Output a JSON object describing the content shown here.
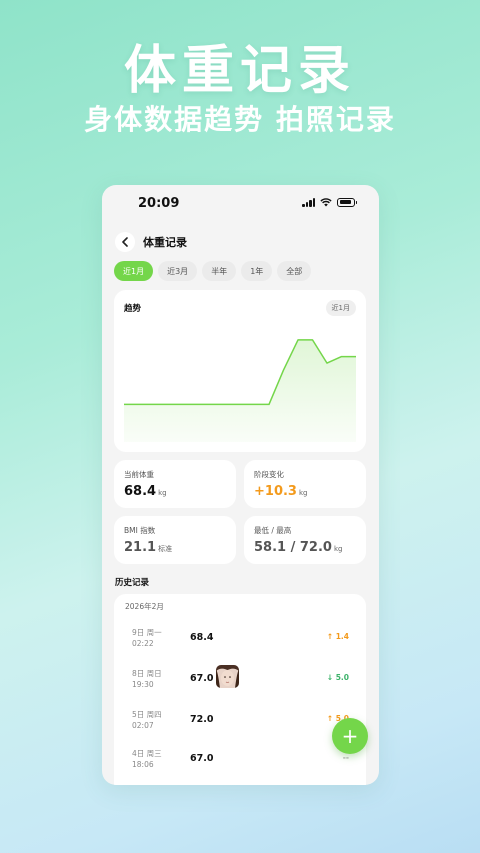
{
  "hero": {
    "title": "体重记录",
    "subtitle": "身体数据趋势 拍照记录"
  },
  "status_bar": {
    "time": "20:09"
  },
  "header": {
    "back_icon": "chevron-left-icon",
    "title": "体重记录"
  },
  "tabs": [
    {
      "label": "近1月",
      "active": true
    },
    {
      "label": "近3月",
      "active": false
    },
    {
      "label": "半年",
      "active": false
    },
    {
      "label": "1年",
      "active": false
    },
    {
      "label": "全部",
      "active": false
    }
  ],
  "trend": {
    "label": "趋势",
    "badge": "近1月",
    "line_color": "#74d64a"
  },
  "chart_data": {
    "type": "area",
    "title": "趋势",
    "xlabel": "",
    "ylabel": "",
    "grid": false,
    "x": [
      1,
      2,
      3,
      4,
      5,
      6,
      7,
      8,
      9,
      10,
      11,
      12,
      13,
      14,
      15,
      16,
      17
    ],
    "values": [
      58.1,
      58.1,
      58.1,
      58.1,
      58.1,
      58.1,
      58.1,
      58.1,
      58.1,
      58.1,
      58.1,
      65.5,
      72.0,
      72.0,
      67.0,
      68.4,
      68.4
    ],
    "ylim": [
      50,
      75
    ]
  },
  "stats": {
    "current": {
      "label": "当前体重",
      "value": "68.4",
      "unit": "kg"
    },
    "change": {
      "label": "阶段变化",
      "value": "+10.3",
      "unit": "kg"
    },
    "bmi": {
      "label": "BMI 指数",
      "value": "21.1",
      "unit": "标准"
    },
    "range": {
      "label": "最低 / 最高",
      "value": "58.1 / 72.0",
      "unit": "kg"
    }
  },
  "history": {
    "title": "历史记录",
    "month": "2026年2月",
    "records": [
      {
        "day": "9日 周一",
        "time": "02:22",
        "weight": "68.4",
        "change": "↑ 1.4",
        "trend": "up",
        "has_photo": false
      },
      {
        "day": "8日 周日",
        "time": "19:30",
        "weight": "67.0",
        "change": "↓ 5.0",
        "trend": "down",
        "has_photo": true
      },
      {
        "day": "5日 周四",
        "time": "02:07",
        "weight": "72.0",
        "change": "↑ 5.0",
        "trend": "up",
        "has_photo": false
      },
      {
        "day": "4日 周三",
        "time": "18:06",
        "weight": "67.0",
        "change": "--",
        "trend": "none",
        "has_photo": false
      }
    ]
  },
  "fab": {
    "label": "+",
    "icon": "plus-icon"
  },
  "colors": {
    "accent": "#74d64a",
    "up": "#f39a1c",
    "down": "#3db36a"
  }
}
